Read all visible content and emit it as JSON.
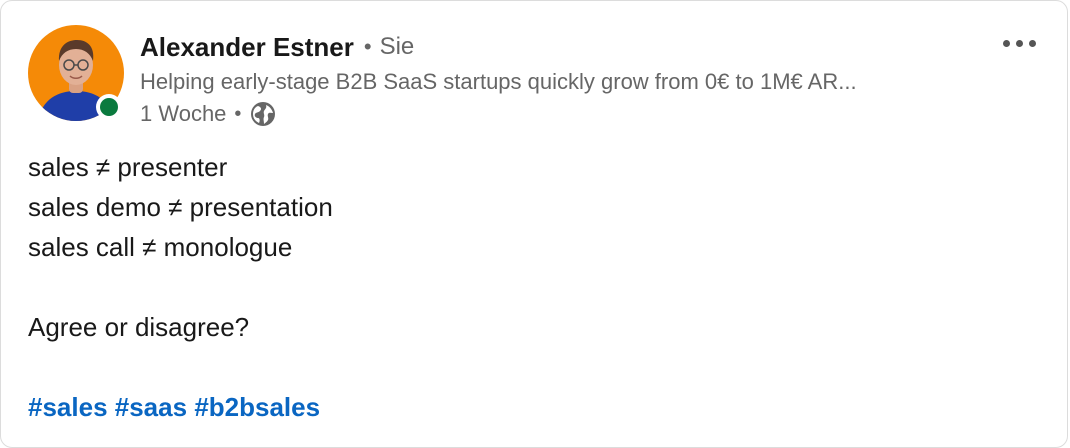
{
  "post": {
    "author": {
      "name": "Alexander Estner",
      "relation": "Sie",
      "headline": "Helping early-stage B2B SaaS startups quickly grow from 0€ to 1M€ AR...",
      "avatar_icon": "profile-photo",
      "online": true
    },
    "meta": {
      "separator": "•",
      "timestamp": "1 Woche",
      "visibility_icon": "globe-icon"
    },
    "body_lines": [
      "sales ≠ presenter",
      "sales demo ≠ presentation",
      "sales call ≠ monologue",
      "",
      "Agree or disagree?",
      ""
    ],
    "hashtags": [
      "#sales",
      "#saas",
      "#b2bsales"
    ],
    "more_icon": "more-options-icon"
  },
  "colors": {
    "link": "#0a66c2",
    "muted": "#666666",
    "text": "#191919",
    "presence": "#0a7a3e",
    "avatar_background": "#f58a07"
  }
}
